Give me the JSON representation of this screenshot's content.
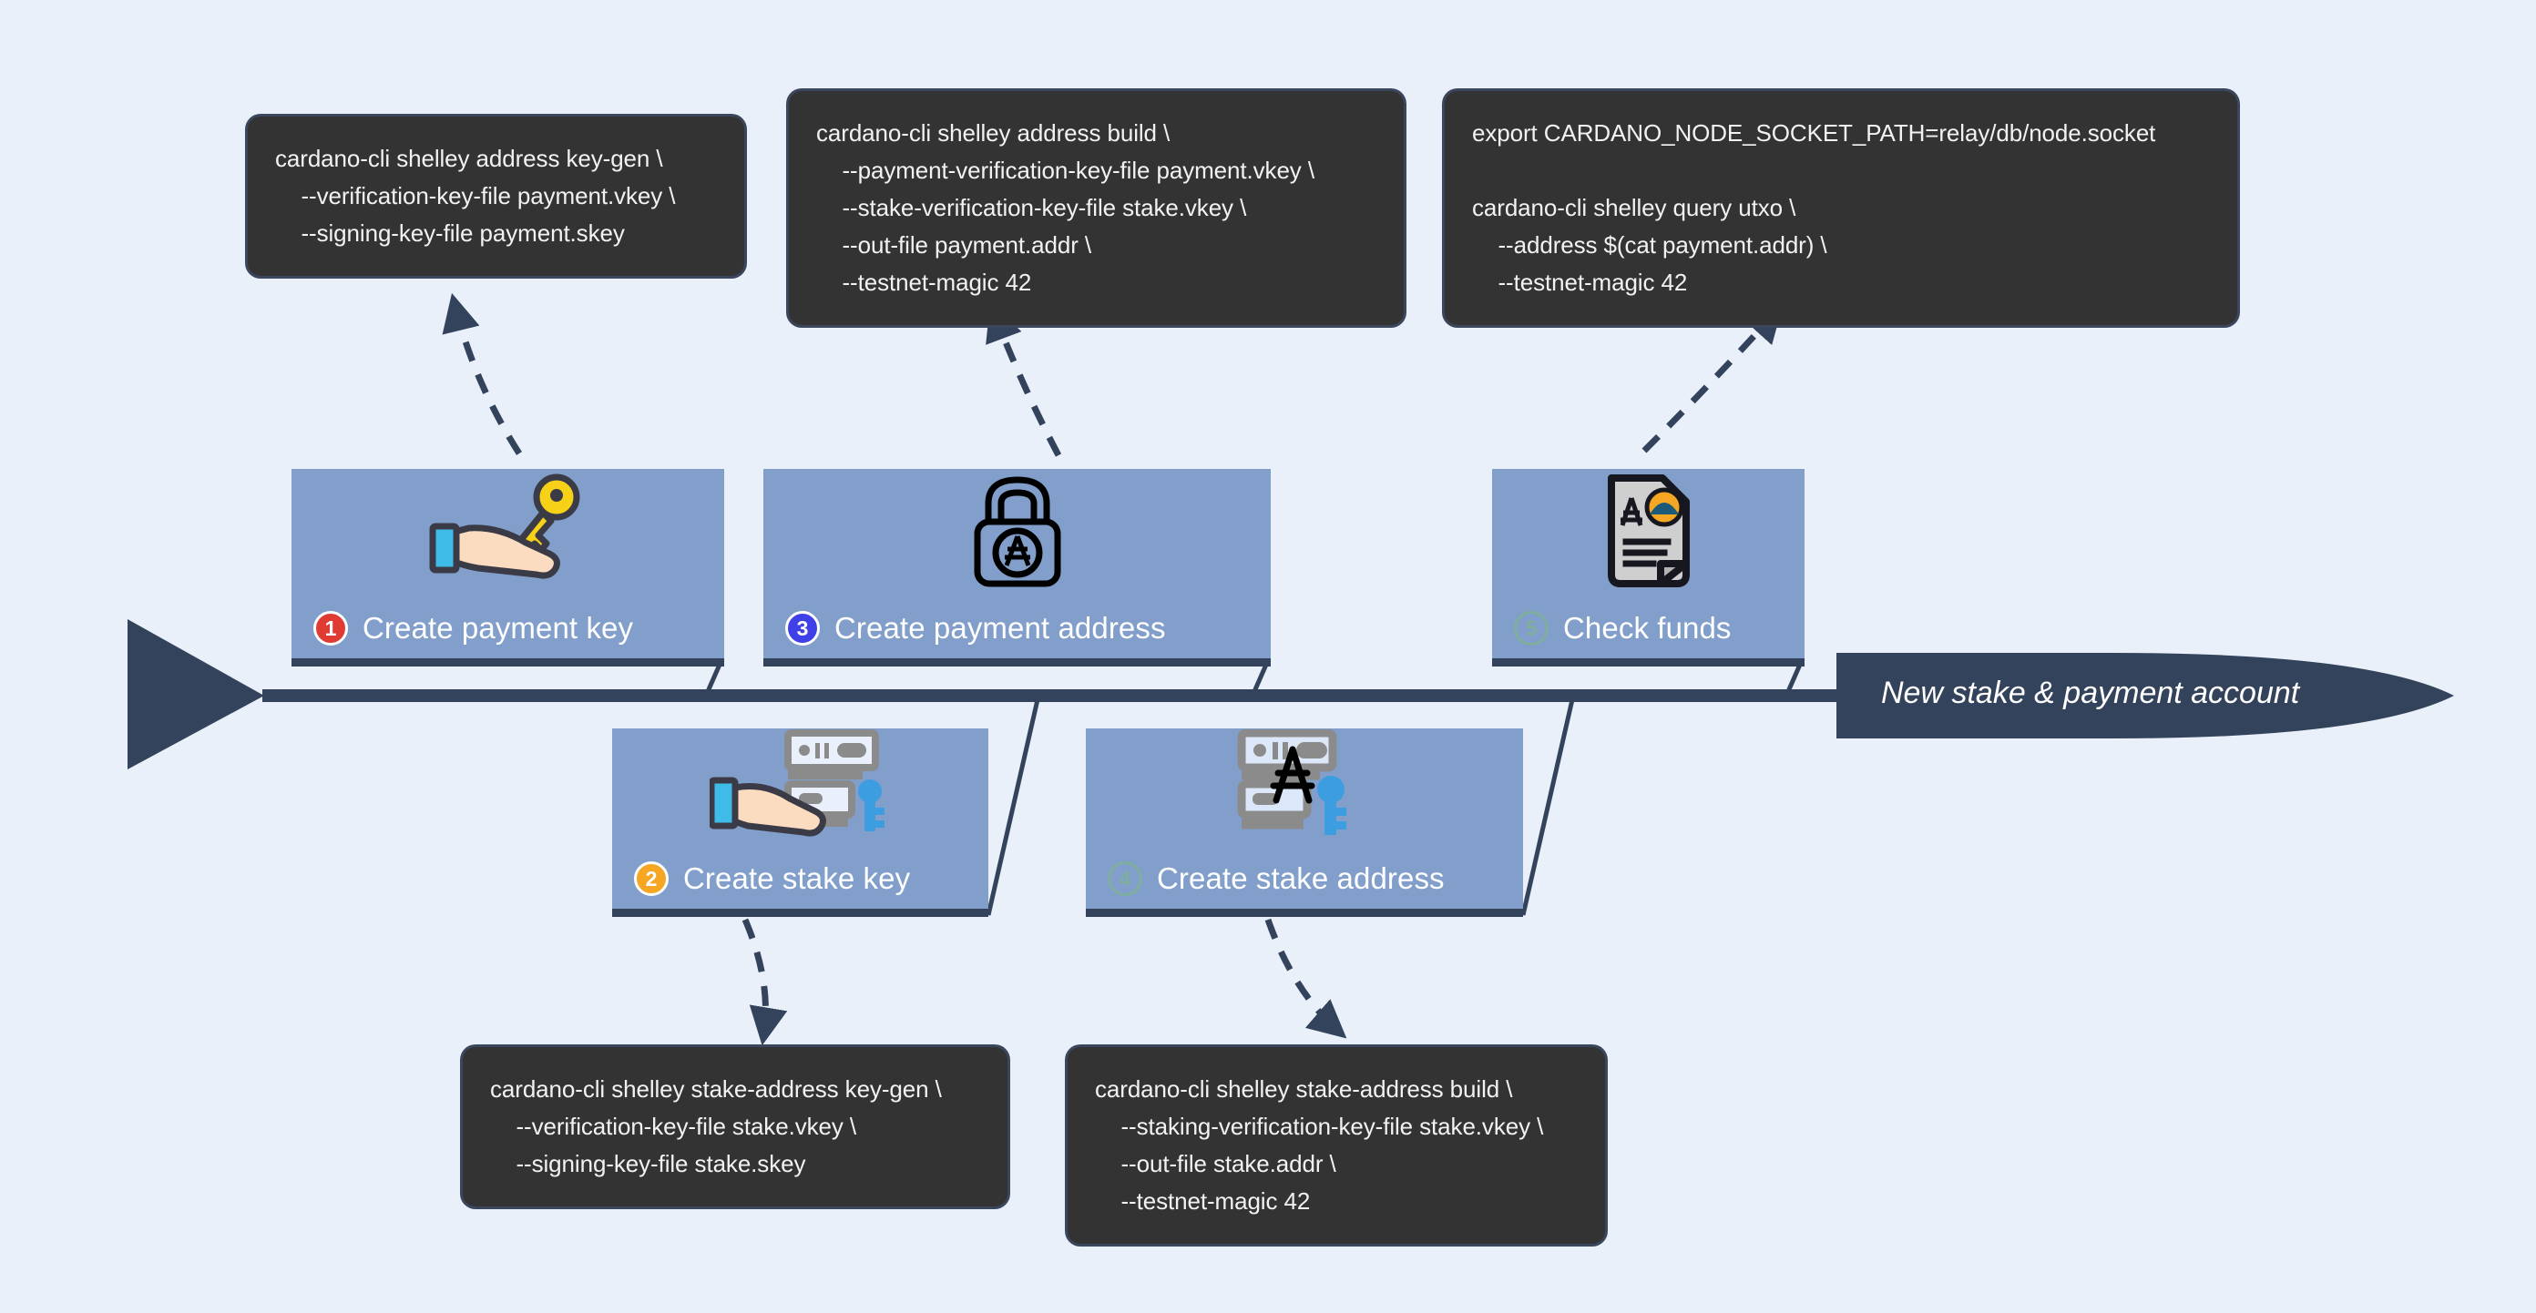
{
  "diagram": {
    "title_label": "New stake & payment account",
    "background_color": "#eaf0f9",
    "spine_color": "#34435c",
    "card_color": "#819fca",
    "code_box_color": "#333334"
  },
  "steps": [
    {
      "number": "1",
      "label": "Create payment key",
      "badge_color": "#e03b33",
      "icon": "hand-holding-key-icon",
      "position": "above"
    },
    {
      "number": "2",
      "label": "Create stake key",
      "badge_color": "#f5a623",
      "icon": "hand-holding-server-key-icon",
      "position": "below"
    },
    {
      "number": "3",
      "label": "Create payment address",
      "badge_color": "#4040e8",
      "icon": "padlock-ada-icon",
      "position": "above"
    },
    {
      "number": "4",
      "label": "Create stake address",
      "badge_color": "#7fae9f",
      "icon": "server-key-ada-icon",
      "position": "below"
    },
    {
      "number": "5",
      "label": "Check funds",
      "badge_color": "#7fae9f",
      "icon": "document-ada-icon",
      "position": "above"
    }
  ],
  "code_boxes": [
    {
      "id": "payment-key-gen",
      "text": "cardano-cli shelley address key-gen \\\n    --verification-key-file payment.vkey \\\n    --signing-key-file payment.skey"
    },
    {
      "id": "payment-address-build",
      "text": "cardano-cli shelley address build \\\n    --payment-verification-key-file payment.vkey \\\n    --stake-verification-key-file stake.vkey \\\n    --out-file payment.addr \\\n    --testnet-magic 42"
    },
    {
      "id": "query-utxo",
      "text": "export CARDANO_NODE_SOCKET_PATH=relay/db/node.socket\n\ncardano-cli shelley query utxo \\\n    --address $(cat payment.addr) \\\n    --testnet-magic 42"
    },
    {
      "id": "stake-key-gen",
      "text": "cardano-cli shelley stake-address key-gen \\\n    --verification-key-file stake.vkey \\\n    --signing-key-file stake.skey"
    },
    {
      "id": "stake-address-build",
      "text": "cardano-cli shelley stake-address build \\\n    --staking-verification-key-file stake.vkey \\\n    --out-file stake.addr \\\n    --testnet-magic 42"
    }
  ]
}
